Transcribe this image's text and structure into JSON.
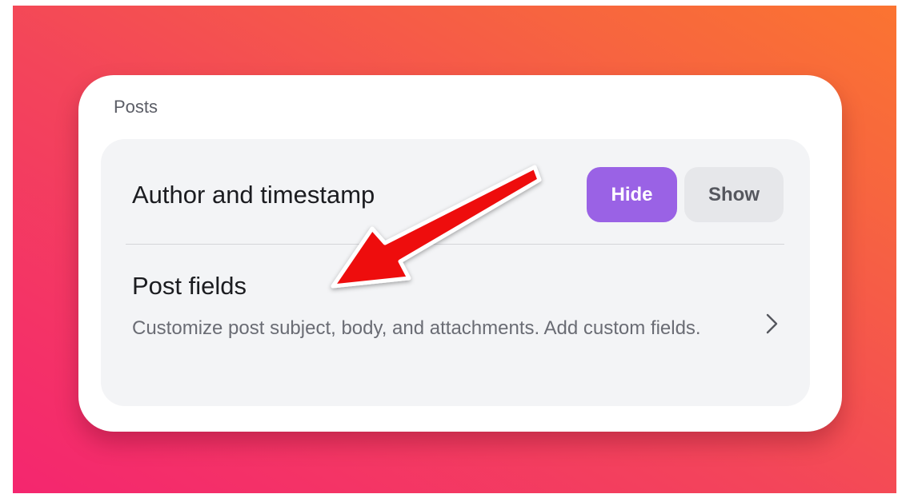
{
  "posts_settings": {
    "section_label": "Posts",
    "author_timestamp": {
      "label": "Author and timestamp",
      "options": [
        "Hide",
        "Show"
      ],
      "selected": "Hide"
    },
    "post_fields": {
      "title": "Post fields",
      "description": "Customize post subject, body, and attachments. Add custom fields."
    }
  },
  "icons": {
    "chevron": "chevron-right-icon",
    "annotation": "red-arrow-annotation-icon"
  },
  "colors": {
    "accent": "#9a62e5",
    "arrow": "#ee1111",
    "background_start": "#f4266f",
    "background_end": "#fb7431"
  }
}
